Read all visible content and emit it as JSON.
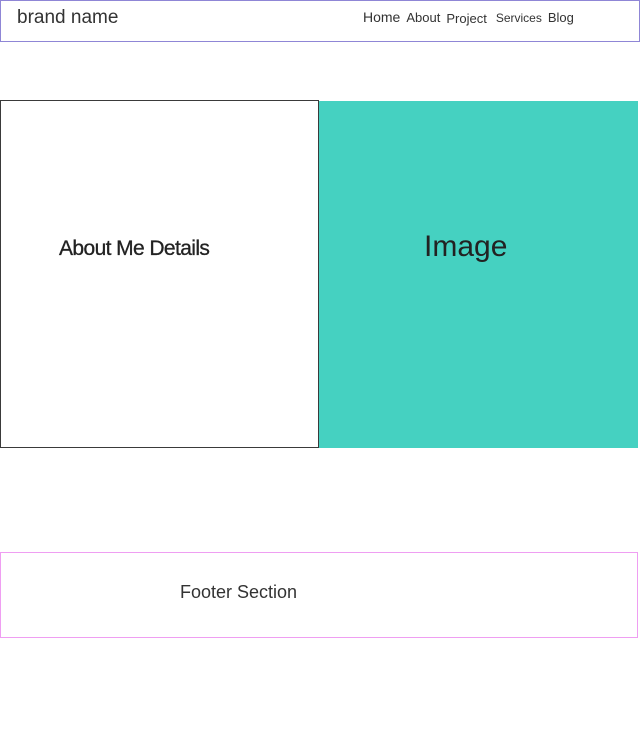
{
  "header": {
    "brand": "brand name",
    "nav": [
      {
        "label": "Home"
      },
      {
        "label": "About"
      },
      {
        "label": "Project"
      },
      {
        "label": "Services"
      },
      {
        "label": "Blog"
      }
    ]
  },
  "main": {
    "about_label": "About Me Details",
    "image_label": "Image"
  },
  "footer": {
    "label": "Footer Section"
  },
  "colors": {
    "header_border": "#8f86d6",
    "about_border": "#3a3a3a",
    "image_background": "#45d1c1",
    "footer_border": "#ef9ef2"
  }
}
